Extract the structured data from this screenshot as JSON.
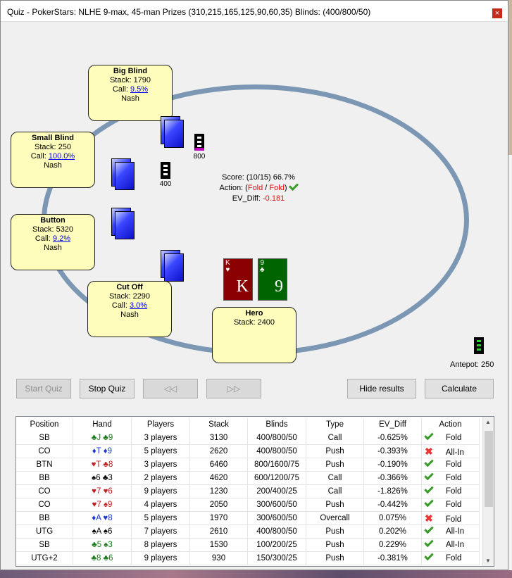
{
  "window": {
    "title": "Quiz - PokerStars: NLHE 9-max, 45-man Prizes (310,215,165,125,90,60,35) Blinds: (400/800/50)",
    "close_icon": "close-icon"
  },
  "seats": {
    "big_blind": {
      "name": "Big Blind",
      "stack": "Stack: 1790",
      "call_label": "Call:",
      "call_value": "9.5%",
      "mode": "Nash"
    },
    "small_blind": {
      "name": "Small Blind",
      "stack": "Stack: 250",
      "call_label": "Call:",
      "call_value": "100.0%",
      "mode": "Nash"
    },
    "button": {
      "name": "Button",
      "stack": "Stack: 5320",
      "call_label": "Call:",
      "call_value": "9.2%",
      "mode": "Nash"
    },
    "cut_off": {
      "name": "Cut Off",
      "stack": "Stack: 2290",
      "call_label": "Call:",
      "call_value": "3.0%",
      "mode": "Nash"
    },
    "hero": {
      "name": "Hero",
      "stack": "Stack: 2400"
    }
  },
  "bets": {
    "bb": "800",
    "sb": "400",
    "antepot_label": "Antepot: 250"
  },
  "score": {
    "line": "Score: (10/15) 66.7%",
    "action_label": "Action: (",
    "action_a": "Fold",
    "sep": " / ",
    "action_b": "Fold",
    "action_close": ")",
    "ev_label": "EV_Diff: ",
    "ev_value": "-0.181"
  },
  "hero_cards": [
    {
      "rank": "K",
      "suit": "♥",
      "color": "#8b0000"
    },
    {
      "rank": "9",
      "suit": "♣",
      "color": "#006400"
    }
  ],
  "buttons": {
    "start": "Start Quiz",
    "stop": "Stop Quiz",
    "prev": "◁◁",
    "next": "▷▷",
    "hide": "Hide results",
    "calc": "Calculate"
  },
  "columns": [
    "Position",
    "Hand",
    "Players",
    "Stack",
    "Blinds",
    "Type",
    "EV_Diff",
    "Action"
  ],
  "rows": [
    {
      "pos": "SB",
      "hand": "♣J ♣9",
      "hc": "#1a7a1a",
      "players": "3 players",
      "stack": "3130",
      "blinds": "400/800/50",
      "type": "Call",
      "ev": "-0.625%",
      "ok": true,
      "action": "Fold"
    },
    {
      "pos": "CO",
      "hand": "♦T ♦9",
      "hc": "#1a3ad0",
      "players": "5 players",
      "stack": "2620",
      "blinds": "400/800/50",
      "type": "Push",
      "ev": "-0.393%",
      "ok": false,
      "action": "All-In"
    },
    {
      "pos": "BTN",
      "hand": "♥T ♣8",
      "hc": "#c02020",
      "players": "3 players",
      "stack": "6460",
      "blinds": "800/1600/75",
      "type": "Push",
      "ev": "-0.190%",
      "ok": true,
      "action": "Fold"
    },
    {
      "pos": "BB",
      "hand": "♠6 ♣3",
      "hc": "#000000",
      "players": "2 players",
      "stack": "4620",
      "blinds": "600/1200/75",
      "type": "Call",
      "ev": "-0.366%",
      "ok": true,
      "action": "Fold"
    },
    {
      "pos": "CO",
      "hand": "♥7 ♥6",
      "hc": "#c02020",
      "players": "9 players",
      "stack": "1230",
      "blinds": "200/400/25",
      "type": "Call",
      "ev": "-1.826%",
      "ok": true,
      "action": "Fold"
    },
    {
      "pos": "CO",
      "hand": "♥7 ♠9",
      "hc": "#c02020",
      "players": "4 players",
      "stack": "2050",
      "blinds": "300/600/50",
      "type": "Push",
      "ev": "-0.442%",
      "ok": true,
      "action": "Fold"
    },
    {
      "pos": "BB",
      "hand": "♦A ♥8",
      "hc": "#1a3ad0",
      "players": "5 players",
      "stack": "1970",
      "blinds": "300/600/50",
      "type": "Overcall",
      "ev": "0.075%",
      "ok": false,
      "action": "Fold"
    },
    {
      "pos": "UTG",
      "hand": "♠A ♠6",
      "hc": "#000000",
      "players": "7 players",
      "stack": "2610",
      "blinds": "400/800/50",
      "type": "Push",
      "ev": "0.202%",
      "ok": true,
      "action": "All-In"
    },
    {
      "pos": "SB",
      "hand": "♣5 ♠3",
      "hc": "#1a7a1a",
      "players": "8 players",
      "stack": "1530",
      "blinds": "100/200/25",
      "type": "Push",
      "ev": "0.229%",
      "ok": true,
      "action": "All-In"
    },
    {
      "pos": "UTG+2",
      "hand": "♣8 ♣6",
      "hc": "#1a7a1a",
      "players": "9 players",
      "stack": "930",
      "blinds": "150/300/25",
      "type": "Push",
      "ev": "-0.381%",
      "ok": true,
      "action": "Fold"
    }
  ]
}
